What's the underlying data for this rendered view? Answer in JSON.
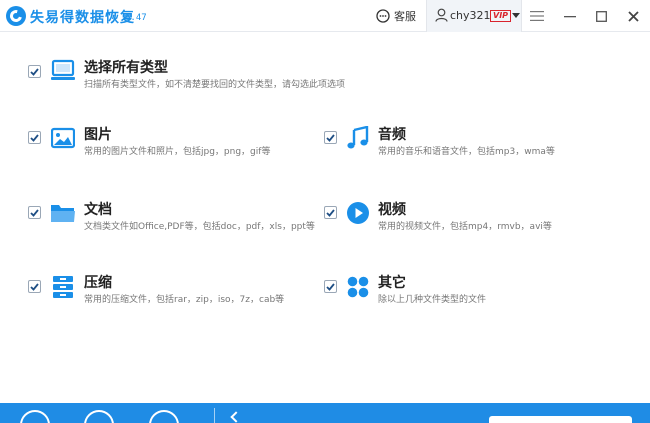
{
  "app": {
    "title": "失易得数据恢复",
    "version": "6.47"
  },
  "header": {
    "support_label": "客服",
    "username": "chy321",
    "vip_label": "VIP"
  },
  "select_all": {
    "title": "选择所有类型",
    "desc": "扫描所有类型文件，如不清楚要找回的文件类型，请勾选此项选项",
    "checked": true
  },
  "categories": [
    {
      "title": "图片",
      "desc": "常用的图片文件和照片，包括jpg，png，gif等",
      "icon": "image-icon",
      "checked": true
    },
    {
      "title": "音频",
      "desc": "常用的音乐和语音文件，包括mp3，wma等",
      "icon": "music-icon",
      "checked": true
    },
    {
      "title": "文档",
      "desc": "文档类文件如Office,PDF等，包括doc，pdf，xls，ppt等",
      "icon": "folder-icon",
      "checked": true
    },
    {
      "title": "视频",
      "desc": "常用的视频文件，包括mp4，rmvb，avi等",
      "icon": "play-icon",
      "checked": true
    },
    {
      "title": "压缩",
      "desc": "常用的压缩文件，包括rar，zip，iso，7z，cab等",
      "icon": "archive-icon",
      "checked": true
    },
    {
      "title": "其它",
      "desc": "除以上几种文件类型的文件",
      "icon": "grid-icon",
      "checked": true
    }
  ],
  "colors": {
    "accent": "#1a8fe8",
    "bottom_bar": "#1f8ce5",
    "vip": "#d9232d"
  }
}
